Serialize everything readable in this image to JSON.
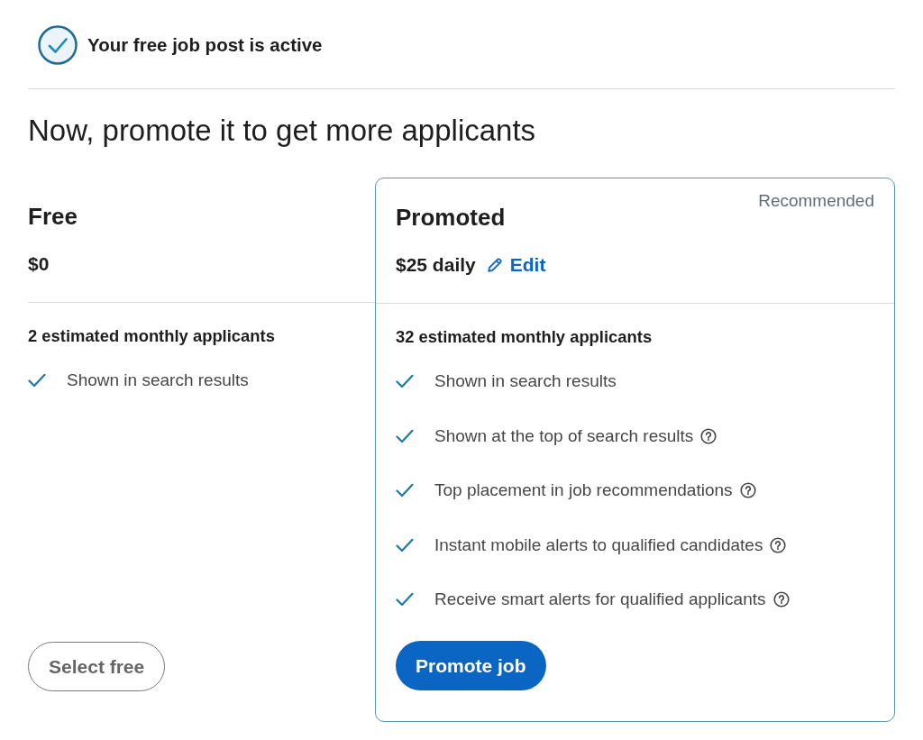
{
  "status": {
    "title": "Your free job post is active"
  },
  "heading": "Now, promote it to get more applicants",
  "plans": [
    {
      "kind": "free",
      "name": "Free",
      "price": "$0",
      "estimate": "2 estimated monthly applicants",
      "features": [
        {
          "text": "Shown in search results",
          "help": false
        }
      ],
      "button": "Select free"
    },
    {
      "kind": "promoted",
      "name": "Promoted",
      "badge": "Recommended",
      "price": "$25 daily",
      "edit": "Edit",
      "estimate": "32 estimated monthly applicants",
      "features": [
        {
          "text": "Shown in search results",
          "help": false
        },
        {
          "text": "Shown at the top of search results",
          "help": true
        },
        {
          "text": "Top placement in job recommendations",
          "help": true
        },
        {
          "text": "Instant mobile alerts to qualified candidates",
          "help": true
        },
        {
          "text": "Receive smart alerts for qualified applicants",
          "help": true
        }
      ],
      "button": "Promote job"
    }
  ]
}
